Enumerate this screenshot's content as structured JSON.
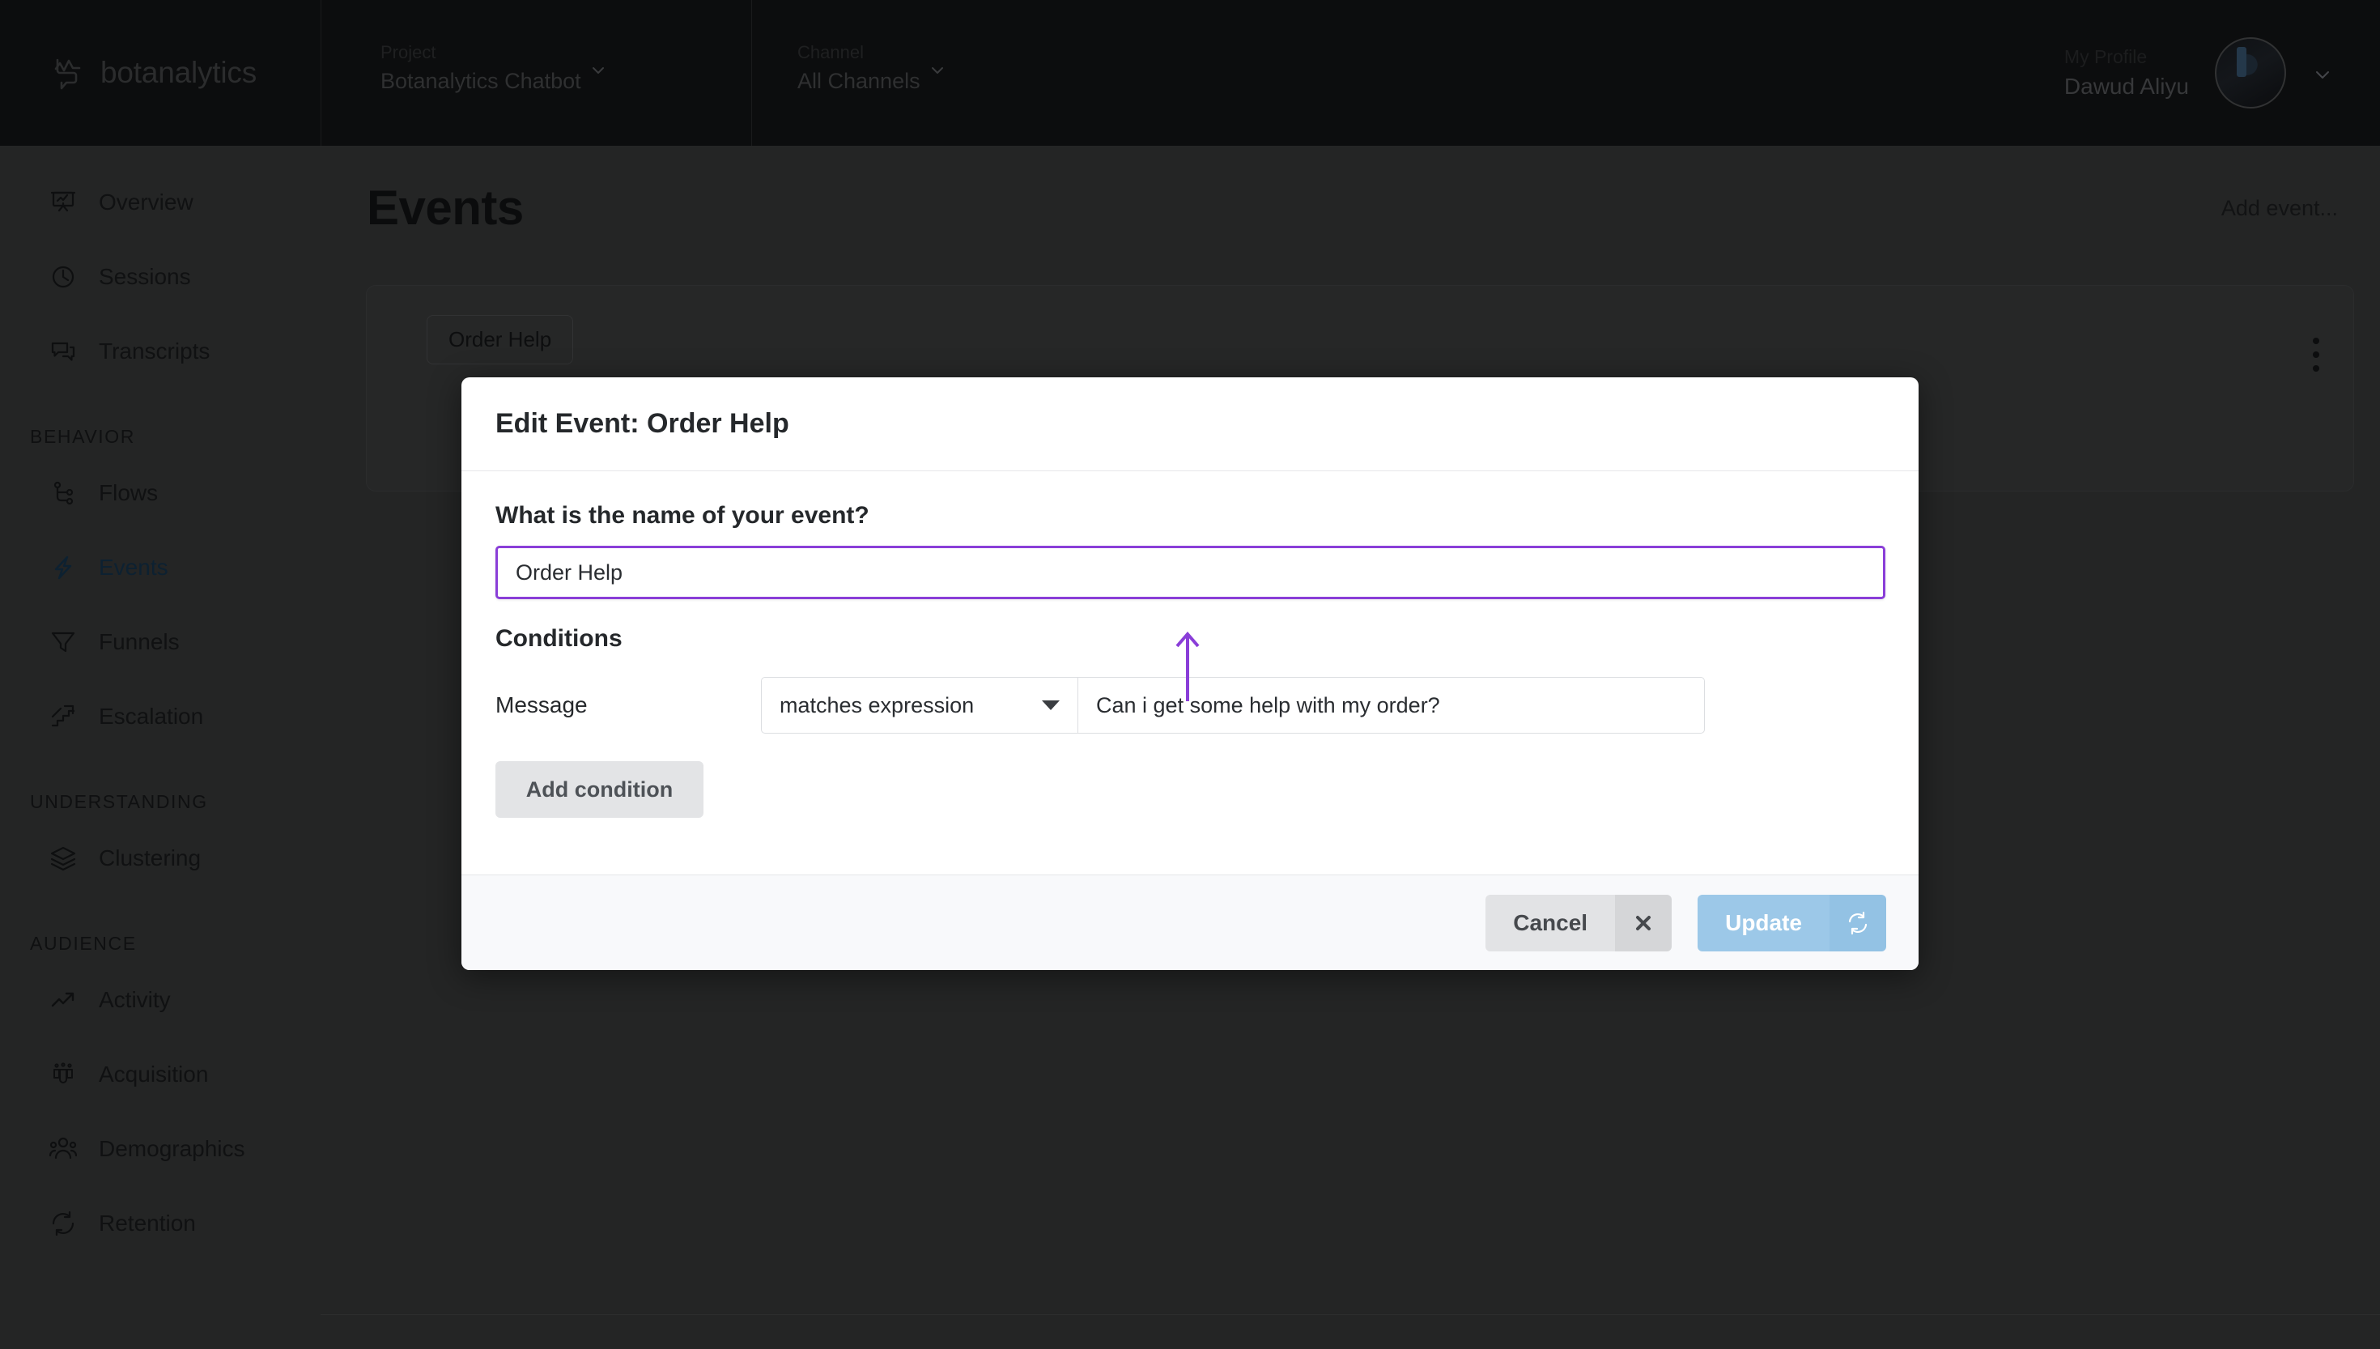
{
  "brand": {
    "name": "botanalytics",
    "logo_icon": "botanalytics-logo-icon"
  },
  "topbar": {
    "project": {
      "caption": "Project",
      "value": "Botanalytics Chatbot",
      "chevron_icon": "chevron-down-icon"
    },
    "channel": {
      "caption": "Channel",
      "value": "All Channels",
      "chevron_icon": "chevron-down-icon"
    },
    "profile": {
      "caption": "My Profile",
      "name": "Dawud Aliyu",
      "avatar_icon": "avatar",
      "chevron_icon": "chevron-down-icon"
    }
  },
  "sidebar": {
    "items": [
      {
        "label": "Overview",
        "icon": "presentation-chart-icon",
        "active": false
      },
      {
        "label": "Sessions",
        "icon": "clock-icon",
        "active": false
      },
      {
        "label": "Transcripts",
        "icon": "chat-bubbles-icon",
        "active": false
      }
    ],
    "sections": [
      {
        "title": "BEHAVIOR",
        "items": [
          {
            "label": "Flows",
            "icon": "flow-nodes-icon",
            "active": false
          },
          {
            "label": "Events",
            "icon": "lightning-bolt-icon",
            "active": true
          },
          {
            "label": "Funnels",
            "icon": "funnel-icon",
            "active": false
          },
          {
            "label": "Escalation",
            "icon": "stairs-arrow-icon",
            "active": false
          }
        ]
      },
      {
        "title": "UNDERSTANDING",
        "items": [
          {
            "label": "Clustering",
            "icon": "layers-icon",
            "active": false
          }
        ]
      },
      {
        "title": "AUDIENCE",
        "items": [
          {
            "label": "Activity",
            "icon": "trending-up-icon",
            "active": false
          },
          {
            "label": "Acquisition",
            "icon": "magnet-people-icon",
            "active": false
          },
          {
            "label": "Demographics",
            "icon": "people-group-icon",
            "active": false
          },
          {
            "label": "Retention",
            "icon": "refresh-cycle-icon",
            "active": false
          }
        ]
      }
    ]
  },
  "page": {
    "title": "Events",
    "add_event_label": "Add event...",
    "event_chip": "Order Help",
    "kebab_icon": "more-vertical-icon"
  },
  "modal": {
    "title": "Edit Event: Order Help",
    "name_question": "What is the name of your event?",
    "name_value": "Order Help",
    "name_placeholder": "Event name",
    "conditions_title": "Conditions",
    "condition": {
      "field_label": "Message",
      "operator": "matches expression",
      "operator_caret_icon": "caret-down-icon",
      "value": "Can i get some help with my order?",
      "value_placeholder": "Value"
    },
    "add_condition_label": "Add condition",
    "cancel_label": "Cancel",
    "cancel_icon": "close-x-icon",
    "update_label": "Update",
    "update_icon": "refresh-icon"
  },
  "annotation": {
    "arrow_icon": "arrow-up-annotation",
    "color": "#8a3ed8"
  },
  "colors": {
    "accent_purple": "#8a3ed8",
    "primary_button": "#9cc8e8",
    "modal_bg": "#ffffff",
    "app_bg": "#242525",
    "topbar_bg": "#0c0d0e"
  }
}
